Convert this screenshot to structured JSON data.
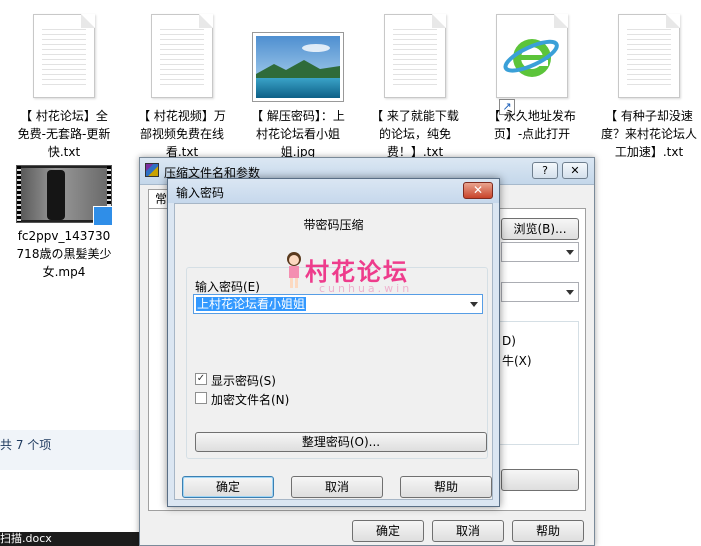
{
  "files": [
    {
      "name": "【 村花论坛】全免费-无套路-更新快.txt",
      "type": "txt"
    },
    {
      "name": "【 村花视频】万部视频免费在线看.txt",
      "type": "txt"
    },
    {
      "name": "【 解压密码】：上村花论坛看小姐姐.jpg",
      "type": "jpg"
    },
    {
      "name": "【 来了就能下载的论坛，纯免费！】.txt",
      "type": "txt"
    },
    {
      "name": "【 永久地址发布页】-点此打开",
      "type": "url"
    },
    {
      "name": "【 有种子却没速度？来村花论坛人工加速】.txt",
      "type": "txt"
    },
    {
      "name": "fc2ppv_143730718歳の黒髪美少女.mp4",
      "type": "mp4"
    }
  ],
  "status": {
    "item_count": "共 7 个项"
  },
  "taskbar": {
    "text": "扫描.docx"
  },
  "back_dialog": {
    "title": "压缩文件名和参数",
    "help_btn": "?",
    "close_btn": "✕",
    "tab_general": "常",
    "browse_btn": "浏览(B)...",
    "ok": "确定",
    "cancel": "取消",
    "help": "帮助",
    "partial_d": "D)",
    "partial_x": "牛(X)"
  },
  "front_dialog": {
    "title": "输入密码",
    "close_btn": "✕",
    "heading": "带密码压缩",
    "password_label": "输入密码(E)",
    "password_value": "上村花论坛看小姐姐",
    "show_password": "显示密码(S)",
    "show_password_checked": true,
    "encrypt_names": "加密文件名(N)",
    "encrypt_names_checked": false,
    "organize_btn": "整理密码(O)...",
    "ok": "确定",
    "cancel": "取消",
    "help": "帮助"
  },
  "watermark": {
    "text": "村花论坛",
    "sub": "cunhua.win"
  }
}
